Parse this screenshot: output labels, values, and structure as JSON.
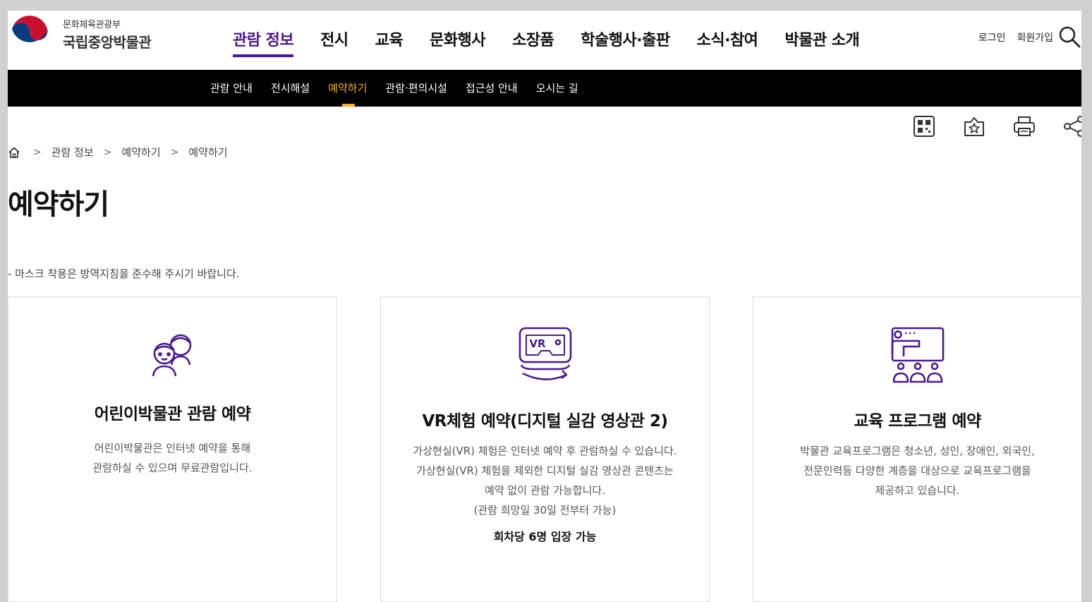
{
  "header": {
    "org_sub": "문화체육관광부",
    "org_main": "국립중앙박물관",
    "gnb": [
      "관람 정보",
      "전시",
      "교육",
      "문화행사",
      "소장품",
      "학술행사·출판",
      "소식·참여",
      "박물관 소개"
    ],
    "login": "로그인",
    "join": "회원가입"
  },
  "lnb": [
    "관람 안내",
    "전시해설",
    "예약하기",
    "관람·편의시설",
    "접근성 안내",
    "오시는 길"
  ],
  "breadcrumb": [
    "관람 정보",
    "예약하기",
    "예약하기"
  ],
  "page_title": "예약하기",
  "notice": "- 마스크 착용은 방역지침을 준수해 주시기 바랍니다.",
  "cards": [
    {
      "title": "어린이박물관 관람 예약",
      "desc1": "어린이박물관은 인터넷 예약을 통해",
      "desc2": "관람하실 수 있으며 무료관람입니다."
    },
    {
      "title": "VR체험 예약(디지털 실감 영상관 2)",
      "desc1": "가상현실(VR) 체험은 인터넷 예약 후 관람하실 수 있습니다.",
      "desc2": "가상현실(VR) 체험을 제외한 디지털 실감 영상관 콘텐츠는",
      "desc3": "예약 없이 관람 가능합니다.",
      "desc4": "(관람 희망일 30일 전부터 가능)",
      "strong": "회차당 6명 입장 가능",
      "icon_text": "VR"
    },
    {
      "title": "교육 프로그램 예약",
      "desc1": "박물관 교육프로그램은 청소년, 성인, 장애인, 외국인,",
      "desc2": "전문인력등 다양한 계층을 대상으로 교육프로그램을",
      "desc3": "제공하고 있습니다."
    }
  ],
  "colors": {
    "accent": "#4b1a8c",
    "lnb_active": "#f3b21b",
    "icon": "#4b1a8c"
  }
}
